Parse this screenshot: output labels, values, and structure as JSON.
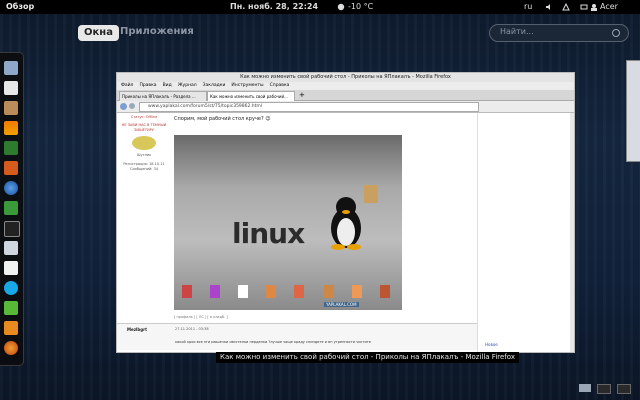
{
  "topbar": {
    "activities": "Обзор",
    "clock": "Пн. нояб. 28, 22:24",
    "weather": "-10 °C",
    "language": "ru",
    "user": "Acer"
  },
  "overview": {
    "tab_windows": "Окна",
    "tab_apps": "Приложения",
    "search_placeholder": "Найти..."
  },
  "dash": {
    "items": [
      "nautilus-icon",
      "text-editor-icon",
      "archive-icon",
      "vlc-icon",
      "system-monitor-icon",
      "software-center-icon",
      "web-browser-icon",
      "spreadsheet-icon",
      "terminal-icon",
      "document-icon",
      "photos-icon",
      "skype-icon",
      "network-icon",
      "settings-icon",
      "firefox-icon"
    ]
  },
  "window": {
    "title": "Как можно изменить свой рабочий стол - Приколы на ЯПлакалъ - Mozilla Firefox",
    "menu": [
      "Файл",
      "Правка",
      "Вид",
      "Журнал",
      "Закладки",
      "Инструменты",
      "Справка"
    ],
    "tabs": [
      "Приколы на ЯПлакалъ - Раздела ...",
      "Как можно изменить свой рабочий..."
    ],
    "url": "www.yaplakal.com/forum5/st/75/topic359862.html",
    "sidebar_user": "Mezlbu",
    "sidebar_lines": [
      "Статус: Offline",
      "НЕ ЗАВИ НАС В ТЕМНЫЙ ЗИШЕТИРУ",
      "Шутник",
      "Регистрация: 18.10.11",
      "Сообщений: 34"
    ],
    "post_text": "Спорим, мой рабочий стол круче? 😉",
    "photo_logo": "linux",
    "watermark": "YAPLAKAL.COM",
    "post_footer": "[ профиль ] [ ЛС ] [ в кладб. ]",
    "post2_user": "Mezlbgrt",
    "post2_date": "27.11.2011 - 03:38",
    "post2_text": "какой кроо все эти рюшечки свистелки перделки ?лучше чаще краду спиндите и вн утренности чистите",
    "right_link": "Новое"
  },
  "caption": "Как можно изменить свой рабочий стол - Приколы на ЯПлакалъ - Mozilla Firefox"
}
